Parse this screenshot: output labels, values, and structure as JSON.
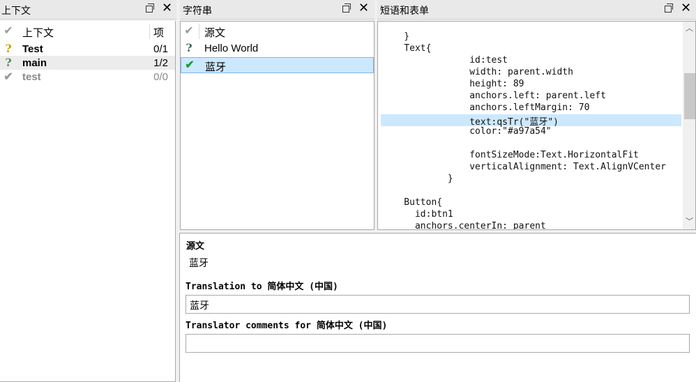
{
  "context_dock": {
    "title": "上下文",
    "col_context": "上下文",
    "col_items": "项",
    "rows": [
      {
        "name": "Test",
        "count": "0/1",
        "icon": "question-icon",
        "color": "#c8a000",
        "bold": true,
        "gray": false
      },
      {
        "name": "main",
        "count": "1/2",
        "icon": "question-icon",
        "color": "#5a8a5a",
        "bold": true,
        "gray": false
      },
      {
        "name": "test",
        "count": "0/0",
        "icon": "check-icon",
        "color": "#9a9a9a",
        "bold": true,
        "gray": true
      }
    ]
  },
  "strings_dock": {
    "title": "字符串",
    "col_source": "源文",
    "rows": [
      {
        "text": "Hello World",
        "icon": "question-icon",
        "color": "#4a6a6a"
      },
      {
        "text": "蓝牙",
        "icon": "check-icon",
        "color": "#1e9a3c"
      }
    ]
  },
  "phrases_dock": {
    "title": "短语和表单",
    "code_lines": [
      "    }",
      "    Text{",
      "                id:test",
      "                width: parent.width",
      "                height: 89",
      "                anchors.left: parent.left",
      "                anchors.leftMargin: 70",
      "                text:qsTr(\"蓝牙\")",
      "                color:\"#a97a54\"",
      "",
      "                fontSizeMode:Text.HorizontalFit",
      "                verticalAlignment: Text.AlignVCenter",
      "            }",
      "",
      "    Button{",
      "      id:btn1",
      "      anchors.centerIn: parent"
    ]
  },
  "editor": {
    "source_label": "源文",
    "source_text": "蓝牙",
    "translation_label": "Translation to 简体中文 (中国)",
    "translation_value": "蓝牙",
    "comments_label": "Translator comments for 简体中文 (中国)",
    "comments_value": ""
  },
  "colors": {
    "selection": "#cce8ff",
    "code_highlight": "#cce8ff"
  }
}
